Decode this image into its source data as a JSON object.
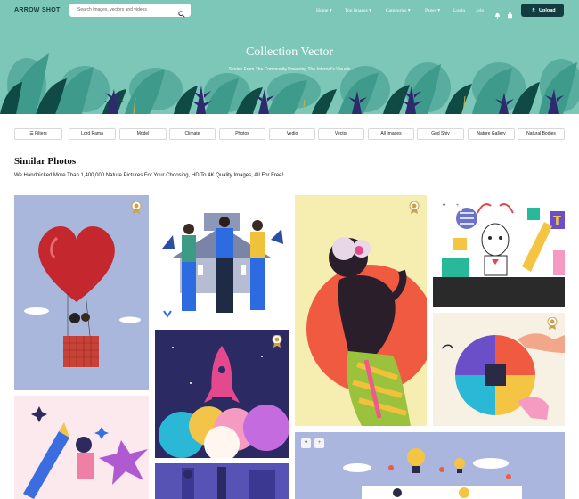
{
  "brand": {
    "logo_text": "ARROW SHOT"
  },
  "search": {
    "placeholder": "Search images, vectors and videos"
  },
  "nav": {
    "items": [
      {
        "label": "Home"
      },
      {
        "label": "Top Images"
      },
      {
        "label": "Categories"
      },
      {
        "label": "Pages"
      },
      {
        "label": "Login"
      },
      {
        "label": "Join"
      }
    ],
    "upload_label": "Upload"
  },
  "hero": {
    "title": "Collection Vector",
    "subtitle": "Stories From The Community Powering The Internet's Visuals"
  },
  "filters": {
    "filters_label": "Filters",
    "chips": [
      "Lord Rama",
      "Model",
      "Climate",
      "Photos",
      "Vedio",
      "Vector",
      "All Images",
      "God Shiv",
      "Nature Gallery",
      "Natural Bodies"
    ]
  },
  "section": {
    "title": "Similar Photos",
    "subtitle": "We Handpicked More Than 1,400,000 Nature Pictures For Your Choosing, HD To 4K Quality Images, All For Free!"
  },
  "colors": {
    "hero_bg": "#7cc7b8",
    "brand_dark": "#123c3f",
    "leaf_dark": "#0f4a44",
    "leaf_purple": "#2e2a6e"
  },
  "icons": {
    "search": "magnifier",
    "notification": "bell",
    "cart": "shopping-bag",
    "upload": "upload-arrow",
    "filters": "sliders"
  }
}
